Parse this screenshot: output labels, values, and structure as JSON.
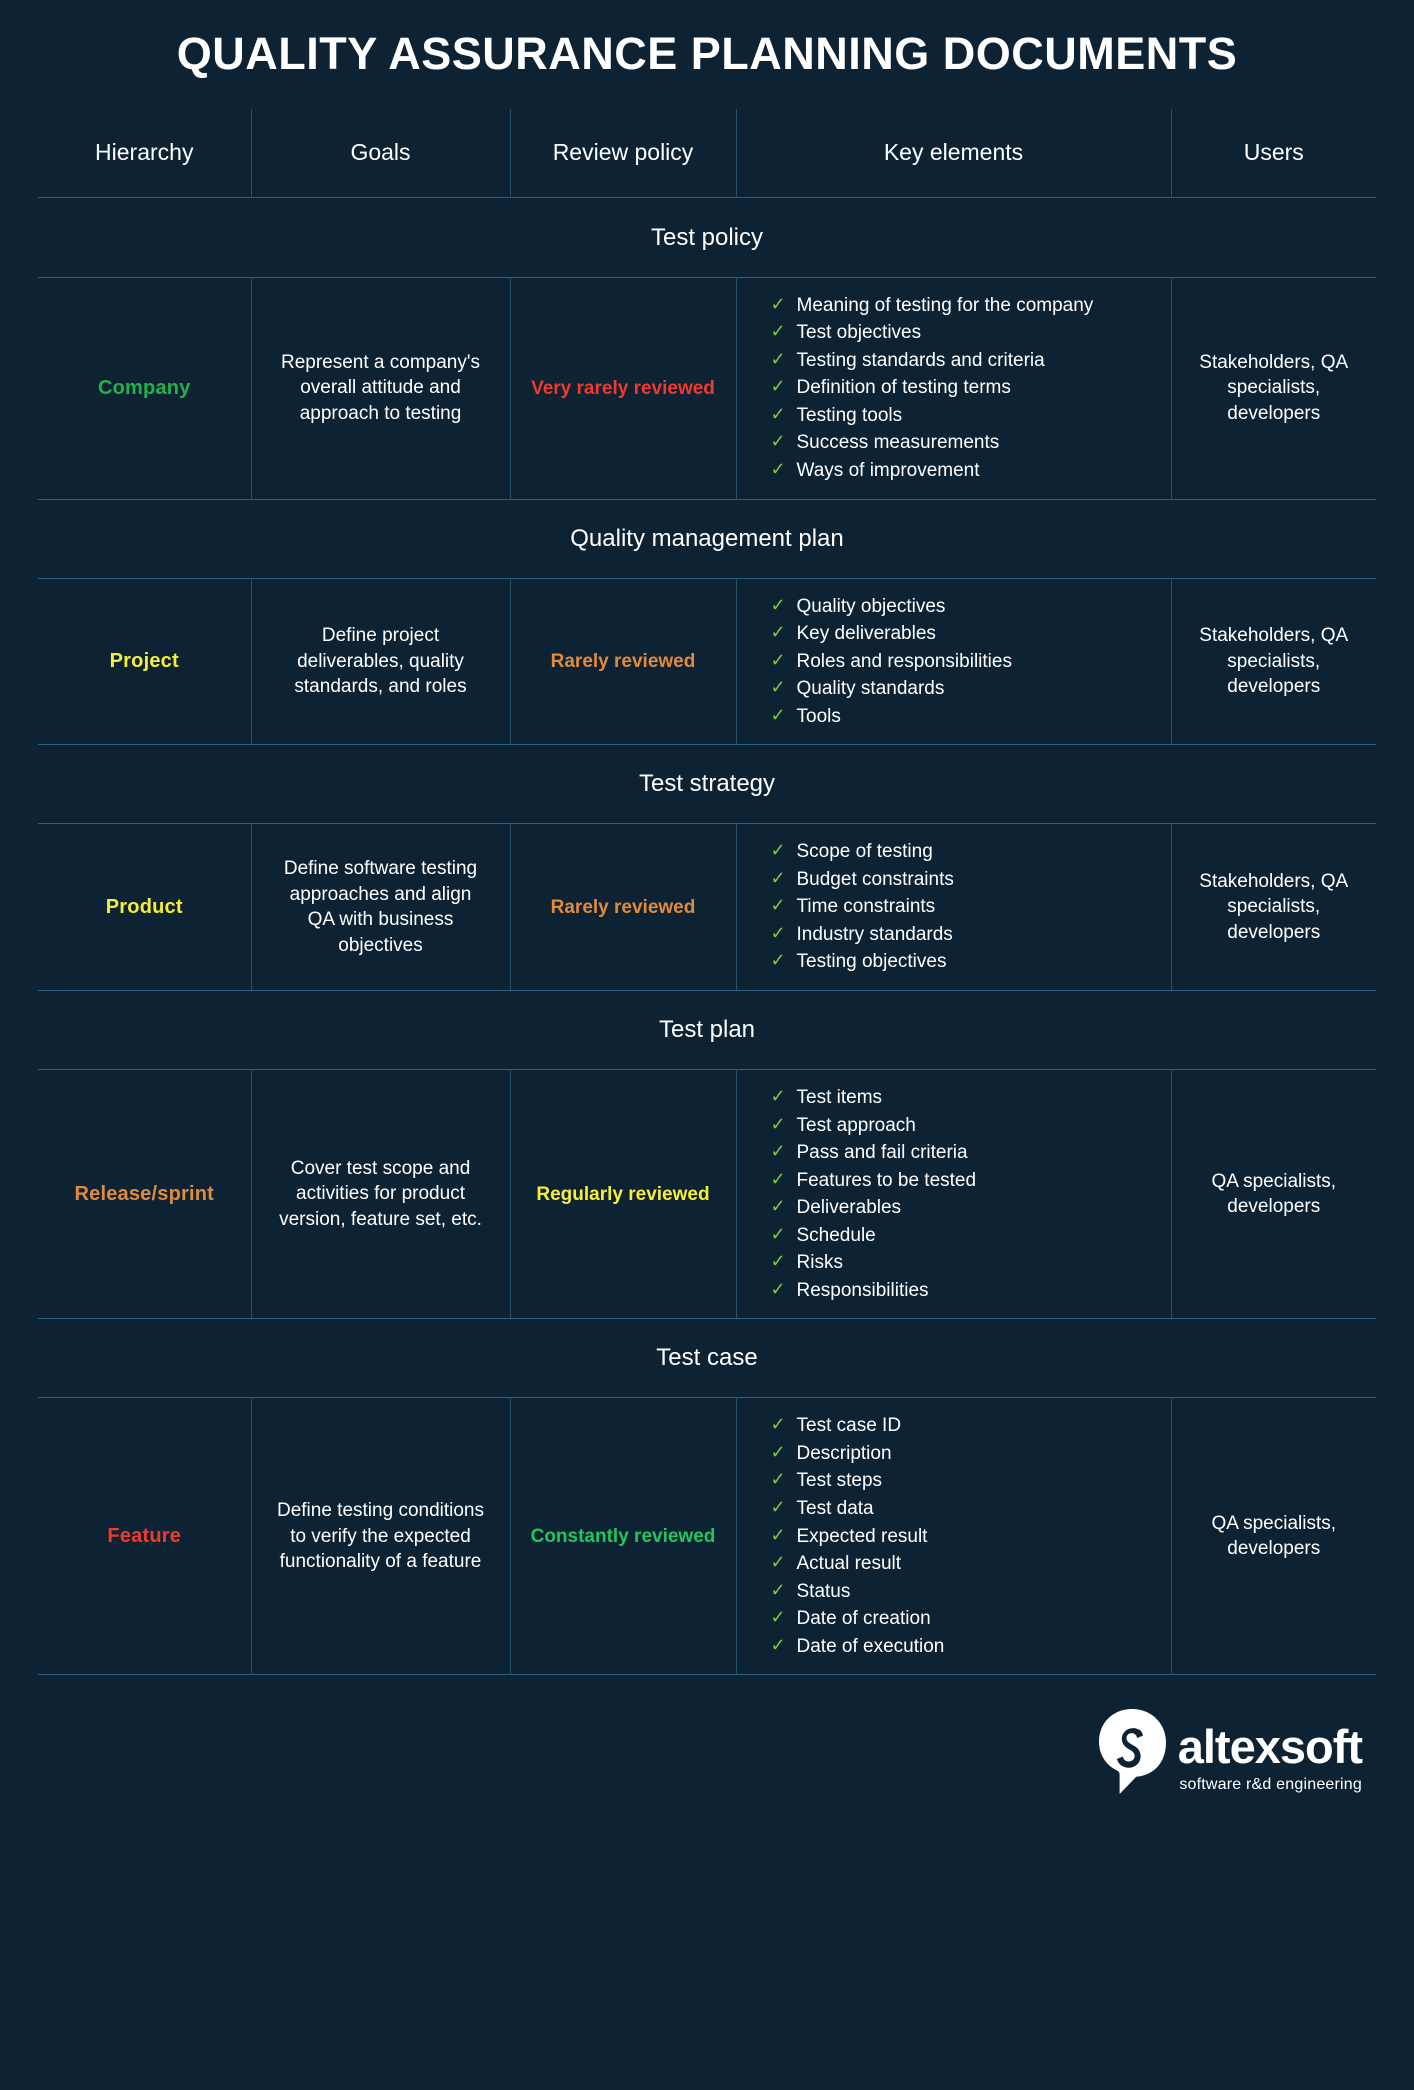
{
  "title": "QUALITY ASSURANCE PLANNING DOCUMENTS",
  "columns": [
    {
      "key": "hierarchy",
      "label": "Hierarchy"
    },
    {
      "key": "goals",
      "label": "Goals"
    },
    {
      "key": "review_policy",
      "label": "Review policy"
    },
    {
      "key": "key_elements",
      "label": "Key elements"
    },
    {
      "key": "users",
      "label": "Users"
    }
  ],
  "colors": {
    "background": "#0d2233",
    "border": "#2c5f80",
    "check": "#7ac943",
    "green": "#22b14c",
    "yellow": "#f5ee3a",
    "orange": "#e08a3c",
    "red": "#ef3a2d",
    "bright_green": "#22c55e",
    "text": "#ffffff"
  },
  "sections": [
    {
      "title": "Test policy",
      "hierarchy": "Company",
      "hierarchy_color": "#22b14c",
      "goals": "Represent a company's overall attitude and approach to testing",
      "review_policy": "Very rarely reviewed",
      "review_color": "#ef3a2d",
      "key_elements": [
        "Meaning of testing for the company",
        "Test objectives",
        "Testing standards and criteria",
        "Definition of testing terms",
        "Testing tools",
        "Success measurements",
        "Ways of improvement"
      ],
      "users": "Stakeholders, QA specialists, developers"
    },
    {
      "title": "Quality management plan",
      "hierarchy": "Project",
      "hierarchy_color": "#f5ee3a",
      "goals": "Define project deliverables, quality standards, and roles",
      "review_policy": "Rarely reviewed",
      "review_color": "#e08a3c",
      "key_elements": [
        "Quality objectives",
        "Key deliverables",
        "Roles and responsibilities",
        "Quality standards",
        "Tools"
      ],
      "users": "Stakeholders, QA specialists, developers"
    },
    {
      "title": "Test strategy",
      "hierarchy": "Product",
      "hierarchy_color": "#f5ee3a",
      "goals": "Define software testing approaches and align QA with business objectives",
      "review_policy": "Rarely reviewed",
      "review_color": "#e08a3c",
      "key_elements": [
        "Scope of testing",
        "Budget constraints",
        "Time constraints",
        "Industry standards",
        "Testing objectives"
      ],
      "users": "Stakeholders, QA specialists, developers"
    },
    {
      "title": "Test plan",
      "hierarchy": "Release/sprint",
      "hierarchy_color": "#e08a3c",
      "goals": "Cover test scope and activities for product version, feature set, etc.",
      "review_policy": "Regularly reviewed",
      "review_color": "#f5ee3a",
      "key_elements": [
        "Test items",
        "Test approach",
        "Pass and fail criteria",
        "Features to be tested",
        "Deliverables",
        "Schedule",
        "Risks",
        "Responsibilities"
      ],
      "users": "QA specialists, developers"
    },
    {
      "title": "Test case",
      "hierarchy": "Feature",
      "hierarchy_color": "#ef3a2d",
      "goals": "Define testing conditions to verify the expected functionality of a feature",
      "review_policy": "Constantly reviewed",
      "review_color": "#22c55e",
      "key_elements": [
        "Test case ID",
        "Description",
        "Test steps",
        "Test data",
        "Expected result",
        "Actual result",
        "Status",
        "Date of creation",
        "Date of execution"
      ],
      "users": "QA specialists, developers"
    }
  ],
  "footer": {
    "brand": "altexsoft",
    "tagline": "software r&d engineering"
  }
}
